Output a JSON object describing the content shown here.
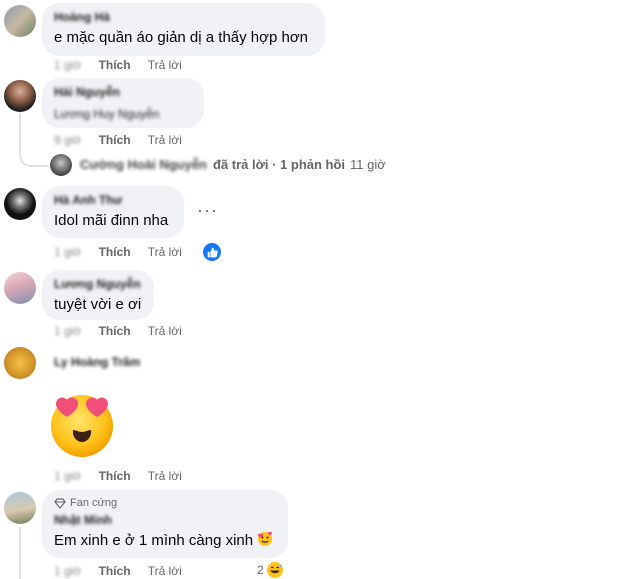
{
  "comments": [
    {
      "author": "Hoàng Hà",
      "text": "e mặc quần áo giản dị a thấy hợp hơn",
      "time": "1 giờ",
      "like_label": "Thích",
      "reply_label": "Trả lời"
    },
    {
      "author": "Hải Nguyễn",
      "text": "Lương Huy Nguyễn",
      "time": "9 giờ",
      "like_label": "Thích",
      "reply_label": "Trả lời"
    },
    {
      "author": "Hà Anh Thư",
      "text": "Idol mãi đinn nha",
      "time": "1 giờ",
      "like_label": "Thích",
      "reply_label": "Trả lời"
    },
    {
      "author": "Lương Nguyễn",
      "text": "tuyệt vời e ơi",
      "time": "1 giờ",
      "like_label": "Thích",
      "reply_label": "Trả lời"
    },
    {
      "author": "Ly Hoàng Trâm",
      "text": "",
      "time": "1 giờ",
      "like_label": "Thích",
      "reply_label": "Trả lời"
    },
    {
      "author": "Nhật Minh",
      "text": "Em xinh e ở 1 mình càng xinh",
      "time": "1 giờ",
      "like_label": "Thích",
      "reply_label": "Trả lời",
      "badge": "Fan cứng",
      "reaction_count": "2"
    }
  ],
  "reply_summary": {
    "who": "Cường Hoài Nguyễn",
    "label": "đã trả lời · 1 phản hồi",
    "ago": "11 giờ"
  },
  "more_dots": "···",
  "colors": {
    "bubble": "#f0f2f5",
    "meta": "#65676b",
    "like_blue": "#1877f2"
  }
}
